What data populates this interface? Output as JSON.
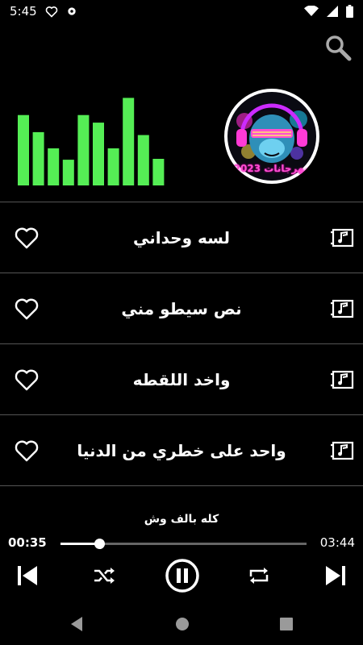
{
  "status_bar": {
    "time": "5:45",
    "icons": [
      "heart-outline-icon",
      "settings-gear-icon",
      "wifi-icon",
      "cellular-signal-icon",
      "battery-icon"
    ]
  },
  "header": {
    "search_icon": "search-icon"
  },
  "album_art": {
    "caption": "مهرجانات 2023"
  },
  "equalizer": {
    "levels": [
      0.74,
      0.56,
      0.39,
      0.27,
      0.74,
      0.66,
      0.39,
      0.92,
      0.53,
      0.28
    ],
    "color": "#55ee55"
  },
  "songs": [
    {
      "title": "لسه وحداني",
      "favorite": false
    },
    {
      "title": "نص سيطو مني",
      "favorite": false
    },
    {
      "title": "واخد اللقطه",
      "favorite": false
    },
    {
      "title": "واحد على خطري من الدنيا",
      "favorite": false
    }
  ],
  "player": {
    "now_playing": "كله بالف وش",
    "elapsed": "0:35",
    "elapsed_display": "00:35",
    "total": "03:44",
    "progress": 0.156,
    "state": "playing",
    "controls": [
      "previous-icon",
      "shuffle-icon",
      "pause-icon",
      "repeat-icon",
      "next-icon"
    ]
  },
  "nav_bar": {
    "buttons": [
      "back",
      "home",
      "recents"
    ]
  },
  "colors": {
    "background": "#000000",
    "accent": "#55ee55",
    "divider": "#555555"
  }
}
